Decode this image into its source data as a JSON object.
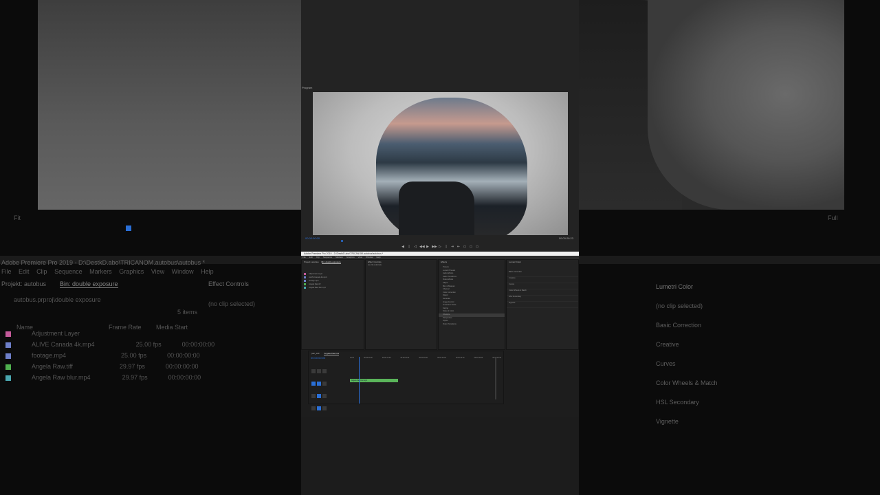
{
  "app": {
    "title": "Adobe Premiere Pro 2019 - D:\\DestkD.abo\\TRICANOM.autobus\\autobus *",
    "menu": [
      "File",
      "Edit",
      "Clip",
      "Sequence",
      "Markers",
      "Graphics",
      "View",
      "Window",
      "Help"
    ]
  },
  "background": {
    "project_tab": "Projekt: autobus",
    "bin_tab": "Bin: double exposure",
    "effect_controls_tab": "Effect Controls",
    "path": "autobus.prproj\\double exposure",
    "items_count": "5 items",
    "no_clip": "(no clip selected)",
    "columns": {
      "name": "Name",
      "frame_rate": "Frame Rate",
      "media_start": "Media Start"
    },
    "rows": [
      {
        "name": "Adjustment Layer",
        "rate": "",
        "start": "",
        "color": "#c45a9a"
      },
      {
        "name": "ALIVE Canada 4k.mp4",
        "rate": "25.00 fps",
        "start": "00:00:00:00",
        "color": "#6d7fc9"
      },
      {
        "name": "footage.mp4",
        "rate": "25.00 fps",
        "start": "00:00:00:00",
        "color": "#6d7fc9"
      },
      {
        "name": "Angela Raw.tiff",
        "rate": "29.97 fps",
        "start": "00:00:00:00",
        "color": "#4fb04f"
      },
      {
        "name": "Angela Raw blur.mp4",
        "rate": "29.97 fps",
        "start": "00:00:00:00",
        "color": "#4aa7b0"
      }
    ],
    "lumetri": {
      "title": "Lumetri Color",
      "no_clip": "(no clip selected)",
      "sections": [
        "Basic Correction",
        "Creative",
        "Curves",
        "Color Wheels & Match",
        "HSL Secondary",
        "Vignette"
      ]
    },
    "program_fit": "Fit",
    "program_fit_right": "Full"
  },
  "monitor": {
    "label": "Program",
    "timecode_left": "00:00:00:00",
    "timecode_right": "00:00:26:23",
    "transport": [
      "◀",
      "|",
      "◁",
      "◀◀",
      "▶",
      "▶▶",
      "▷",
      "|",
      "⇥",
      "⇤",
      "▭",
      "▭",
      "▭"
    ]
  },
  "premiere_small": {
    "project_panel": {
      "tabs": [
        "Project: autobus",
        "Bin: double exposure"
      ],
      "rows": [
        {
          "name": "Adjustment Layer",
          "color": "#c45a9a"
        },
        {
          "name": "ALIVE Canada 4k.mp4",
          "color": "#6d7fc9"
        },
        {
          "name": "footage.mp4",
          "color": "#6d7fc9"
        },
        {
          "name": "Angela Raw.tiff",
          "color": "#4fb04f"
        },
        {
          "name": "Angela Raw blur.mp4",
          "color": "#4aa7b0"
        }
      ]
    },
    "effect_controls": {
      "tab": "Effect Controls",
      "text": "(no clip selected)"
    },
    "effects_panel": {
      "tab": "Effects",
      "items": [
        "Presets",
        "Lumetri Presets",
        "Audio Effects",
        "Audio Transitions",
        "Video Effects",
        "Adjust",
        "Blur & Sharpen",
        "Channel",
        "Color Correction",
        "Distort",
        "Generate",
        "Image Control",
        "Immersive Video",
        "Keying",
        "Noise & Grain",
        "Obsolete",
        "Perspective",
        "Stylize",
        "Video Transitions"
      ]
    },
    "lumetri_panel": {
      "tab": "Lumetri Color",
      "sections": [
        "Basic Correction",
        "Creative",
        "Curves",
        "Color Wheels & Match",
        "HSL Secondary",
        "Vignette"
      ]
    },
    "timeline": {
      "tabs": [
        "pan_edit",
        "Angela Raw blur"
      ],
      "timecode": "00:00:00:00",
      "ruler": [
        "00:00",
        "00:00:05:00",
        "00:00:10:00",
        "00:00:15:00",
        "00:00:20:00",
        "00:00:25:00",
        "00:00:30:00",
        "00:00:35:00",
        "00:00:40:00"
      ],
      "clip_label": "Angela Raw blur.mp4",
      "clip_color": "#5ab55a"
    }
  },
  "colors": {
    "accent": "#2a6fd6",
    "panel_bg": "#232323"
  }
}
